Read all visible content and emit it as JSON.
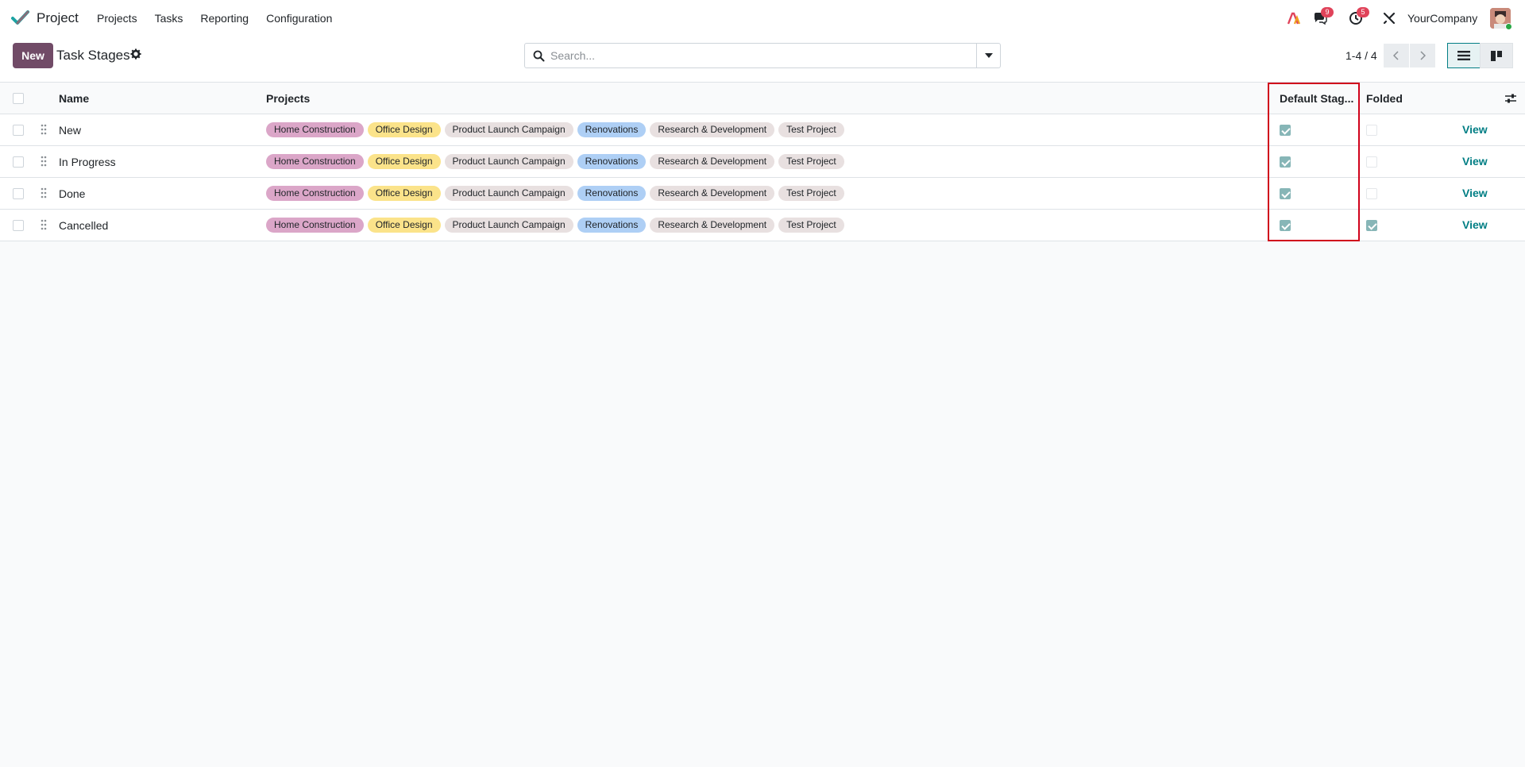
{
  "nav": {
    "app_name": "Project",
    "menu": [
      "Projects",
      "Tasks",
      "Reporting",
      "Configuration"
    ],
    "messages_badge": "9",
    "activity_badge": "5",
    "company": "YourCompany"
  },
  "control": {
    "new_label": "New",
    "title": "Task Stages",
    "search_placeholder": "Search...",
    "pager": "1-4 / 4"
  },
  "table": {
    "columns": [
      "Name",
      "Projects",
      "Default Stag...",
      "Folded"
    ],
    "view_label": "View",
    "tag_colors": {
      "Home Construction": "#dba6c8",
      "Office Design": "#fbe38a",
      "Product Launch Campaign": "#e8e0e0",
      "Renovations": "#aecff5",
      "Research & Development": "#e8e0e0",
      "Test Project": "#e8e0e0"
    },
    "rows": [
      {
        "name": "New",
        "projects": [
          "Home Construction",
          "Office Design",
          "Product Launch Campaign",
          "Renovations",
          "Research & Development",
          "Test Project"
        ],
        "default_stage": true,
        "folded": false
      },
      {
        "name": "In Progress",
        "projects": [
          "Home Construction",
          "Office Design",
          "Product Launch Campaign",
          "Renovations",
          "Research & Development",
          "Test Project"
        ],
        "default_stage": true,
        "folded": false
      },
      {
        "name": "Done",
        "projects": [
          "Home Construction",
          "Office Design",
          "Product Launch Campaign",
          "Renovations",
          "Research & Development",
          "Test Project"
        ],
        "default_stage": true,
        "folded": false
      },
      {
        "name": "Cancelled",
        "projects": [
          "Home Construction",
          "Office Design",
          "Product Launch Campaign",
          "Renovations",
          "Research & Development",
          "Test Project"
        ],
        "default_stage": true,
        "folded": true
      }
    ]
  }
}
